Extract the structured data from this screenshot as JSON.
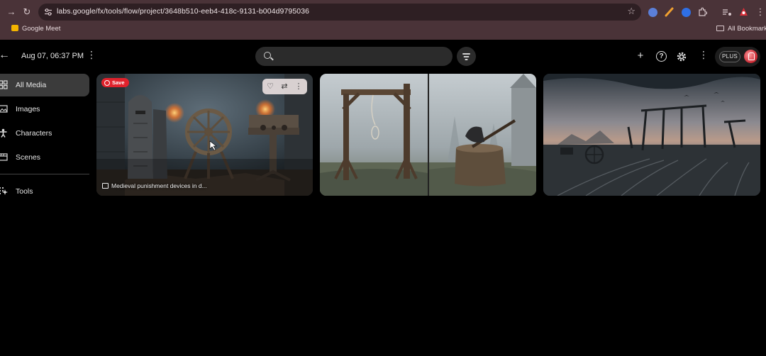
{
  "browser": {
    "url": "labs.google/fx/tools/flow/project/3648b510-eeb4-418c-9131-b004d9795036",
    "bookmarks": [
      {
        "label": "Google Meet",
        "icon": "google-meet-icon"
      }
    ],
    "all_bookmarks_label": "All Bookmarks",
    "theme_color": "#4a3338"
  },
  "header": {
    "date": "Aug 07, 06:37 PM",
    "search": {
      "value": "",
      "placeholder": ""
    },
    "plan_label": "PLUS"
  },
  "sidebar": {
    "items": [
      {
        "label": "All Media",
        "icon": "grid-icon",
        "active": true
      },
      {
        "label": "Images",
        "icon": "image-icon",
        "active": false
      },
      {
        "label": "Characters",
        "icon": "person-icon",
        "active": false
      },
      {
        "label": "Scenes",
        "icon": "film-icon",
        "active": false
      },
      {
        "label": "Tools",
        "icon": "tools-icon",
        "active": false
      }
    ]
  },
  "media": [
    {
      "badge": "Save",
      "caption": "Medieval punishment devices in d...",
      "hovered": true
    },
    {
      "caption": ""
    },
    {
      "caption": ""
    }
  ],
  "colors": {
    "background": "#000000",
    "active_item": "#3b3b3b",
    "save_badge": "#e0222c"
  }
}
